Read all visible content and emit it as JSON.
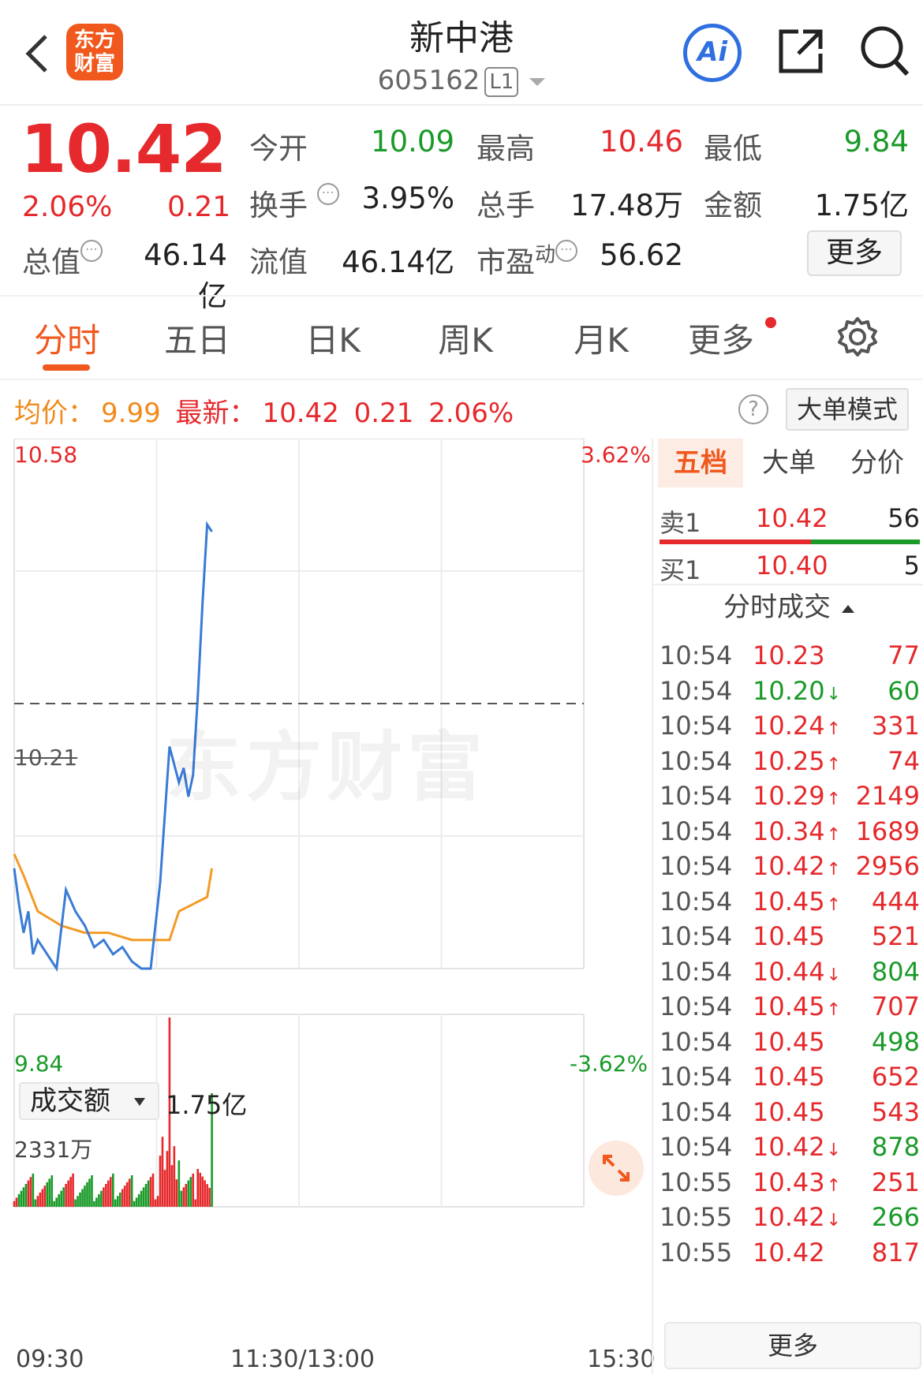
{
  "header": {
    "logo_text": "东方财富",
    "stock_name": "新中港",
    "stock_code": "605162",
    "level": "L1",
    "ai_label": "Ai"
  },
  "quote": {
    "price": "10.42",
    "change_pct": "2.06%",
    "change": "0.21",
    "open_label": "今开",
    "open": "10.09",
    "high_label": "最高",
    "high": "10.46",
    "low_label": "最低",
    "low": "9.84",
    "turnover_label": "换手",
    "turnover": "3.95%",
    "volume_label": "总手",
    "volume": "17.48万",
    "amount_label": "金额",
    "amount": "1.75亿",
    "mktcap_label": "总值",
    "mktcap": "46.14亿",
    "float_label": "流值",
    "float_cap": "46.14亿",
    "pe_label": "市盈",
    "pe_sup": "动",
    "pe": "56.62",
    "more_label": "更多"
  },
  "tabs": [
    {
      "label": "分时",
      "active": true
    },
    {
      "label": "五日"
    },
    {
      "label": "日K"
    },
    {
      "label": "周K"
    },
    {
      "label": "月K"
    },
    {
      "label": "更多"
    }
  ],
  "avg_row": {
    "avg_label": "均价：",
    "avg_value": "9.99",
    "latest_label": "最新：",
    "latest_value": "10.42",
    "change": "0.21",
    "change_pct": "2.06%",
    "mode_label": "大单模式"
  },
  "chart": {
    "y_max": "10.58",
    "y_min": "9.84",
    "y_mid": "10.21",
    "pct_max": "3.62%",
    "pct_min": "-3.62%",
    "watermark": "东方财富",
    "vol_selector": "成交额",
    "vol_total": "1.75亿",
    "vol_max": "2331万",
    "time_start": "09:30",
    "time_mid": "11:30/13:00",
    "time_end": "15:30"
  },
  "chart_data": {
    "type": "line",
    "title": "",
    "xlabel": "",
    "ylabel": "",
    "ylim": [
      9.84,
      10.58
    ],
    "x_ticks": [
      "09:30",
      "11:30/13:00",
      "15:30"
    ],
    "reference_price": 10.21,
    "series": [
      {
        "x": [
          0,
          2,
          4,
          6,
          8,
          10,
          14,
          18,
          22,
          26,
          30,
          34,
          38,
          42,
          46,
          50,
          54,
          58,
          62,
          66,
          70,
          72,
          74,
          76,
          78,
          80,
          82,
          84
        ],
        "values": [
          9.98,
          9.93,
          9.89,
          9.92,
          9.86,
          9.88,
          9.86,
          9.84,
          9.95,
          9.92,
          9.9,
          9.87,
          9.88,
          9.86,
          9.87,
          9.85,
          9.84,
          9.84,
          9.96,
          10.15,
          10.1,
          10.12,
          10.08,
          10.11,
          10.22,
          10.35,
          10.46,
          10.45
        ],
        "color": "#3a7bd5"
      },
      {
        "x": [
          0,
          4,
          10,
          20,
          30,
          40,
          50,
          60,
          66,
          70,
          76,
          82,
          84
        ],
        "values": [
          10.0,
          9.97,
          9.92,
          9.9,
          9.89,
          9.89,
          9.88,
          9.88,
          9.88,
          9.92,
          9.93,
          9.94,
          9.98
        ],
        "color": "#f29b26"
      }
    ],
    "volume_unit": "万",
    "volume_max": 2331
  },
  "right_panel": {
    "tabs": [
      "五档",
      "大单",
      "分价"
    ],
    "sell1": {
      "label": "卖1",
      "price": "10.42",
      "vol": "56"
    },
    "buy1": {
      "label": "买1",
      "price": "10.40",
      "vol": "5"
    },
    "ticks_header": "分时成交",
    "ticks": [
      {
        "t": "10:54",
        "p": "10.23",
        "a": "",
        "v": "77",
        "pc": "red",
        "vc": "red"
      },
      {
        "t": "10:54",
        "p": "10.20",
        "a": "↓",
        "v": "60",
        "pc": "green",
        "vc": "green"
      },
      {
        "t": "10:54",
        "p": "10.24",
        "a": "↑",
        "v": "331",
        "pc": "red",
        "vc": "red"
      },
      {
        "t": "10:54",
        "p": "10.25",
        "a": "↑",
        "v": "74",
        "pc": "red",
        "vc": "red"
      },
      {
        "t": "10:54",
        "p": "10.29",
        "a": "↑",
        "v": "2149",
        "pc": "red",
        "vc": "red"
      },
      {
        "t": "10:54",
        "p": "10.34",
        "a": "↑",
        "v": "1689",
        "pc": "red",
        "vc": "red"
      },
      {
        "t": "10:54",
        "p": "10.42",
        "a": "↑",
        "v": "2956",
        "pc": "red",
        "vc": "red"
      },
      {
        "t": "10:54",
        "p": "10.45",
        "a": "↑",
        "v": "444",
        "pc": "red",
        "vc": "red"
      },
      {
        "t": "10:54",
        "p": "10.45",
        "a": "",
        "v": "521",
        "pc": "red",
        "vc": "red"
      },
      {
        "t": "10:54",
        "p": "10.44",
        "a": "↓",
        "v": "804",
        "pc": "red",
        "vc": "green"
      },
      {
        "t": "10:54",
        "p": "10.45",
        "a": "↑",
        "v": "707",
        "pc": "red",
        "vc": "red"
      },
      {
        "t": "10:54",
        "p": "10.45",
        "a": "",
        "v": "498",
        "pc": "red",
        "vc": "green"
      },
      {
        "t": "10:54",
        "p": "10.45",
        "a": "",
        "v": "652",
        "pc": "red",
        "vc": "red"
      },
      {
        "t": "10:54",
        "p": "10.45",
        "a": "",
        "v": "543",
        "pc": "red",
        "vc": "red"
      },
      {
        "t": "10:54",
        "p": "10.42",
        "a": "↓",
        "v": "878",
        "pc": "red",
        "vc": "green"
      },
      {
        "t": "10:55",
        "p": "10.43",
        "a": "↑",
        "v": "251",
        "pc": "red",
        "vc": "red"
      },
      {
        "t": "10:55",
        "p": "10.42",
        "a": "↓",
        "v": "266",
        "pc": "red",
        "vc": "green"
      },
      {
        "t": "10:55",
        "p": "10.42",
        "a": "",
        "v": "817",
        "pc": "red",
        "vc": "red"
      }
    ],
    "more_label": "更多"
  },
  "colors": {
    "up": "#e5292c",
    "down": "#1a9a29",
    "accent": "#f0581d",
    "price_line": "#3a7bd5",
    "avg_line": "#f29b26"
  }
}
